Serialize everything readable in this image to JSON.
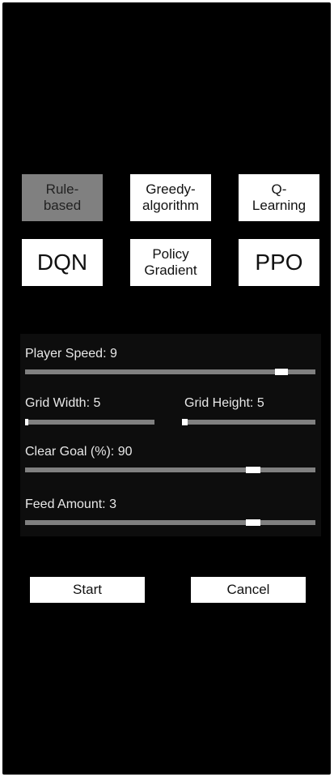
{
  "algorithms": {
    "rule_based": "Rule-\nbased",
    "greedy": "Greedy-\nalgorithm",
    "q_learning": "Q-\nLearning",
    "dqn": "DQN",
    "policy_gradient": "Policy\nGradient",
    "ppo": "PPO",
    "selected": "rule_based"
  },
  "settings": {
    "player_speed": {
      "label": "Player Speed: 9",
      "value": 9,
      "fraction": 0.9
    },
    "grid_width": {
      "label": "Grid Width: 5",
      "value": 5,
      "fraction": 0.0
    },
    "grid_height": {
      "label": "Grid Height: 5",
      "value": 5,
      "fraction": 0.0
    },
    "clear_goal": {
      "label": "Clear Goal (%): 90",
      "value": 90,
      "fraction": 0.8
    },
    "feed_amount": {
      "label": "Feed Amount: 3",
      "value": 3,
      "fraction": 0.8
    }
  },
  "actions": {
    "start_label": "Start",
    "cancel_label": "Cancel"
  },
  "colors": {
    "background": "#000000",
    "button": "#ffffff",
    "selected_button": "#808080",
    "track": "#808080",
    "thumb": "#ffffff"
  }
}
